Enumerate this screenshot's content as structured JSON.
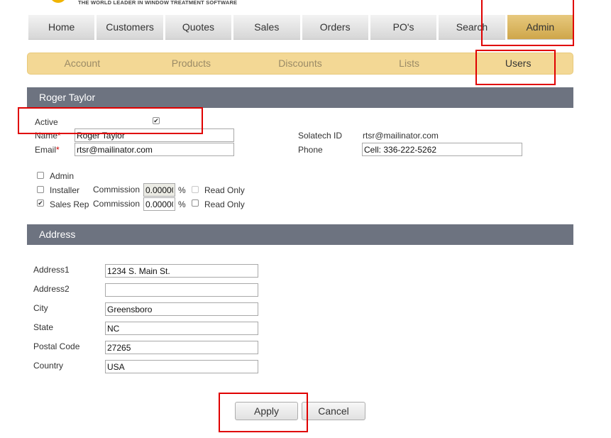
{
  "brand": {
    "tagline": "THE WORLD LEADER IN WINDOW TREATMENT SOFTWARE",
    "logo_color": "#f0b400"
  },
  "topnav": {
    "items": [
      "Home",
      "Customers",
      "Quotes",
      "Sales",
      "Orders",
      "PO's",
      "Search",
      "Admin"
    ],
    "active": "Admin"
  },
  "subnav": {
    "items": [
      "Account",
      "Products",
      "Discounts",
      "Lists",
      "Users"
    ],
    "active": "Users"
  },
  "user_section": {
    "title": "Roger Taylor",
    "active_label": "Active",
    "active_checked": true,
    "name_label": "Name",
    "name_value": "Roger Taylor",
    "email_label": "Email",
    "email_value": "rtsr@mailinator.com",
    "solatech_id_label": "Solatech ID",
    "solatech_id_value": "rtsr@mailinator.com",
    "phone_label": "Phone",
    "phone_value": "Cell: 336-222-5262"
  },
  "roles": {
    "admin_label": "Admin",
    "admin_checked": false,
    "installer_label": "Installer",
    "installer_checked": false,
    "installer_commission": "0.00000",
    "installer_read_only": false,
    "sales_rep_label": "Sales Rep",
    "sales_rep_checked": true,
    "sales_rep_commission": "0.00000",
    "sales_rep_read_only": false,
    "commission_label": "Commission",
    "percent": "%",
    "read_only_label": "Read Only"
  },
  "address_section": {
    "title": "Address",
    "address1_label": "Address1",
    "address1_value": "1234 S. Main St.",
    "address2_label": "Address2",
    "address2_value": "",
    "city_label": "City",
    "city_value": "Greensboro",
    "state_label": "State",
    "state_value": "NC",
    "postal_code_label": "Postal Code",
    "postal_code_value": "27265",
    "country_label": "Country",
    "country_value": "USA"
  },
  "actions": {
    "apply_label": "Apply",
    "cancel_label": "Cancel"
  },
  "colors": {
    "active_tab": "#cfa64a",
    "subnav_bg": "#f3d895",
    "section_header": "#6d7380",
    "highlight": "#e00000"
  }
}
